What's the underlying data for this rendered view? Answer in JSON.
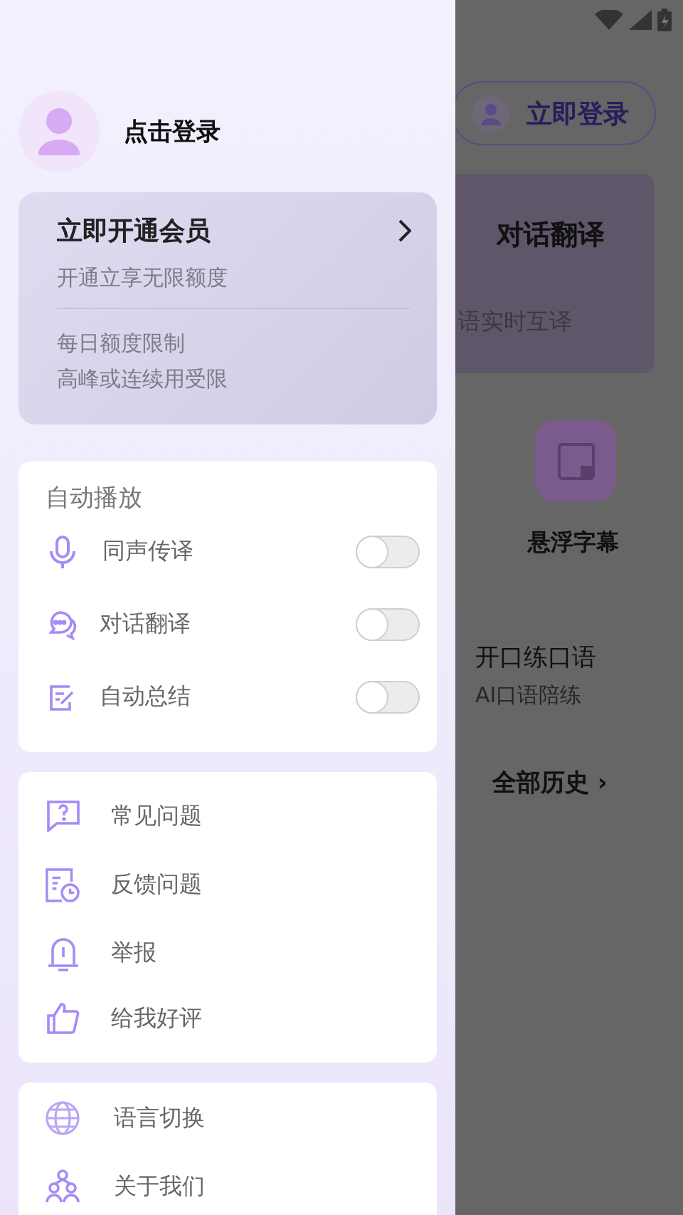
{
  "drawer": {
    "profile": {
      "name": "点击登录"
    },
    "membership": {
      "title": "立即开通会员",
      "subtitle": "开通立享无限额度",
      "limits": [
        "每日额度限制",
        "高峰或连续用受限"
      ]
    },
    "auto_play": {
      "title": "自动播放",
      "items": [
        {
          "kind": "mic",
          "label": "同声传译",
          "on": false
        },
        {
          "kind": "chat",
          "label": "对话翻译",
          "on": false
        },
        {
          "kind": "note",
          "label": "自动总结",
          "on": false
        }
      ]
    },
    "help_items": [
      {
        "kind": "question",
        "label": "常见问题"
      },
      {
        "kind": "feedback",
        "label": "反馈问题"
      },
      {
        "kind": "alarm",
        "label": "举报"
      },
      {
        "kind": "thumb",
        "label": "给我好评"
      }
    ],
    "other_items": [
      {
        "kind": "globe",
        "label": "语言切换"
      },
      {
        "kind": "people",
        "label": "关于我们"
      }
    ]
  },
  "background": {
    "login_button": "立即登录",
    "feature_card": {
      "title": "对话翻译",
      "subtitle": "语实时互译"
    },
    "tile": {
      "label": "悬浮字幕"
    },
    "practice": {
      "title": "开口练口语",
      "subtitle": "AI口语陪练"
    },
    "history_link": "全部历史 ›"
  }
}
